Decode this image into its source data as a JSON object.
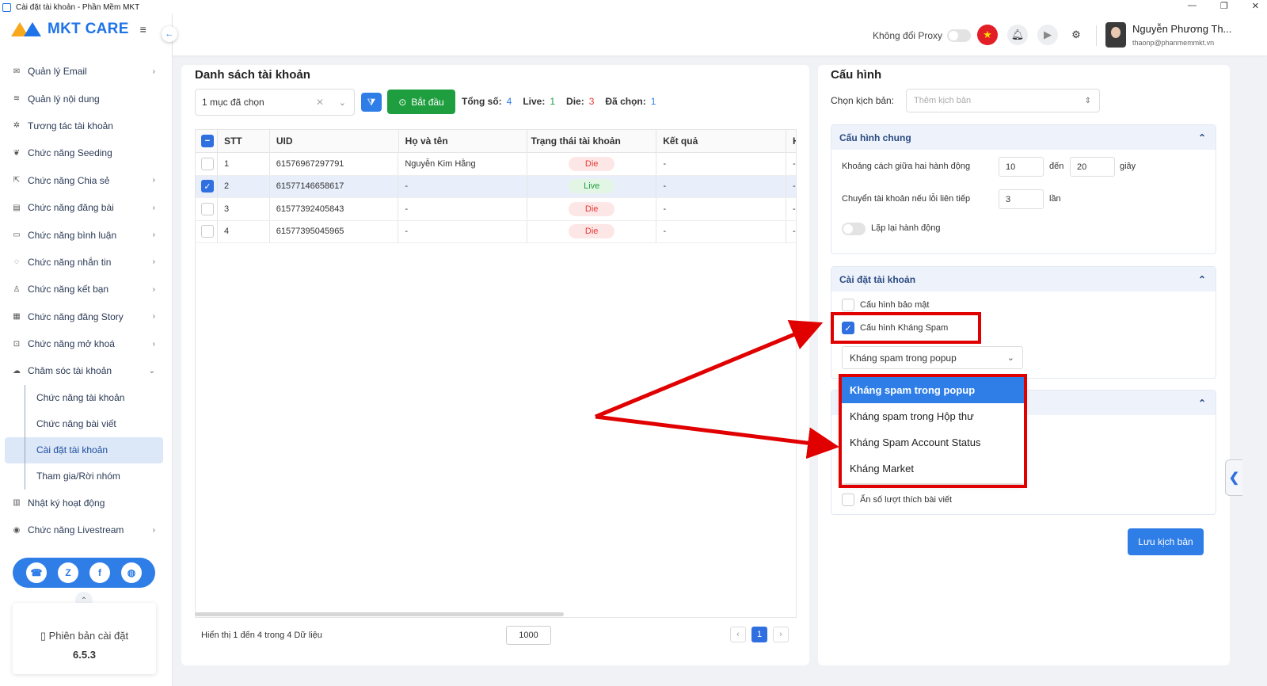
{
  "window": {
    "title": "Cài đặt tài khoản - Phần Mềm MKT"
  },
  "brand": {
    "name": "MKT CARE"
  },
  "sidebar": {
    "items": [
      {
        "label": "Quản lý Email",
        "icon": "mail-icon",
        "chevron": true
      },
      {
        "label": "Quản lý nội dung",
        "icon": "content-icon",
        "chevron": false
      },
      {
        "label": "Tương tác tài khoản",
        "icon": "interact-icon",
        "chevron": false
      },
      {
        "label": "Chức năng Seeding",
        "icon": "seeding-icon",
        "chevron": false
      },
      {
        "label": "Chức năng Chia sẻ",
        "icon": "share-icon",
        "chevron": true
      },
      {
        "label": "Chức năng đăng bài",
        "icon": "post-icon",
        "chevron": true
      },
      {
        "label": "Chức năng bình luận",
        "icon": "comment-icon",
        "chevron": true
      },
      {
        "label": "Chức năng nhắn tin",
        "icon": "message-icon",
        "chevron": true
      },
      {
        "label": "Chức năng kết bạn",
        "icon": "add-friend-icon",
        "chevron": true
      },
      {
        "label": "Chức năng đăng Story",
        "icon": "story-icon",
        "chevron": true
      },
      {
        "label": "Chức năng mở khoá",
        "icon": "unlock-icon",
        "chevron": true
      },
      {
        "label": "Chăm sóc tài khoản",
        "icon": "care-icon",
        "chevron": true
      }
    ],
    "subitems": [
      {
        "label": "Chức năng tài khoản"
      },
      {
        "label": "Chức năng bài viết"
      },
      {
        "label": "Cài đặt tài khoản"
      },
      {
        "label": "Tham gia/Rời nhóm"
      }
    ],
    "bottom_items": [
      {
        "label": "Nhật ký hoạt động",
        "icon": "log-icon"
      },
      {
        "label": "Chức năng Livestream",
        "icon": "livestream-icon"
      }
    ],
    "version_label": "Phiên bản cài đặt",
    "version_number": "6.5.3"
  },
  "header": {
    "proxy_label": "Không đổi Proxy",
    "user_name": "Nguyễn Phương Th...",
    "user_email": "thaonp@phanmemmkt.vn"
  },
  "accounts": {
    "title": "Danh sách tài khoản",
    "select_value": "1 mục đã chọn",
    "start_label": "Bắt đầu",
    "stats": {
      "total_label": "Tổng số:",
      "total": "4",
      "live_label": "Live:",
      "live": "1",
      "die_label": "Die:",
      "die": "3",
      "selected_label": "Đã chọn:",
      "selected": "1"
    },
    "columns": [
      "STT",
      "UID",
      "Họ và tên",
      "Trạng thái tài khoản",
      "Kết quả",
      "H"
    ],
    "rows": [
      {
        "stt": "1",
        "uid": "61576967297791",
        "name": "Nguyễn Kim Hằng",
        "status": "Die",
        "result": "-",
        "extra": "-"
      },
      {
        "stt": "2",
        "uid": "61577146658617",
        "name": "-",
        "status": "Live",
        "result": "-",
        "extra": "-"
      },
      {
        "stt": "3",
        "uid": "61577392405843",
        "name": "-",
        "status": "Die",
        "result": "-",
        "extra": "-"
      },
      {
        "stt": "4",
        "uid": "61577395045965",
        "name": "-",
        "status": "Die",
        "result": "-",
        "extra": "-"
      }
    ],
    "footer_info": "Hiển thị 1 đến 4 trong 4 Dữ liệu",
    "page_size": "1000",
    "current_page": "1"
  },
  "config": {
    "title": "Cấu hình",
    "script_label": "Chọn kịch bản:",
    "script_placeholder": "Thêm kịch bản",
    "general": {
      "title": "Cấu hình chung",
      "interval_label": "Khoảng cách giữa hai hành động",
      "interval_from": "10",
      "to_label": "đến",
      "interval_to": "20",
      "unit_seconds": "giây",
      "switch_label": "Chuyển tài khoản nếu lỗi liên tiếp",
      "switch_value": "3",
      "unit_times": "lần",
      "repeat_label": "Lặp lại hành động"
    },
    "account_settings": {
      "title": "Cài đặt tài khoản",
      "security_label": "Cấu hình bảo mật",
      "antispam_label": "Cấu hình Kháng Spam",
      "antispam_value": "Kháng spam trong popup",
      "antispam_options": [
        "Kháng spam trong popup",
        "Kháng spam trong Hộp thư",
        "Kháng Spam Account Status",
        "Kháng Market"
      ],
      "hide_likes_label": "Ẩn số lượt thích bài viết"
    },
    "save_label": "Lưu kịch bản"
  },
  "colors": {
    "primary": "#2f7ee8",
    "success": "#1e9e3e",
    "danger": "#e53935",
    "annotation": "#e10000"
  }
}
